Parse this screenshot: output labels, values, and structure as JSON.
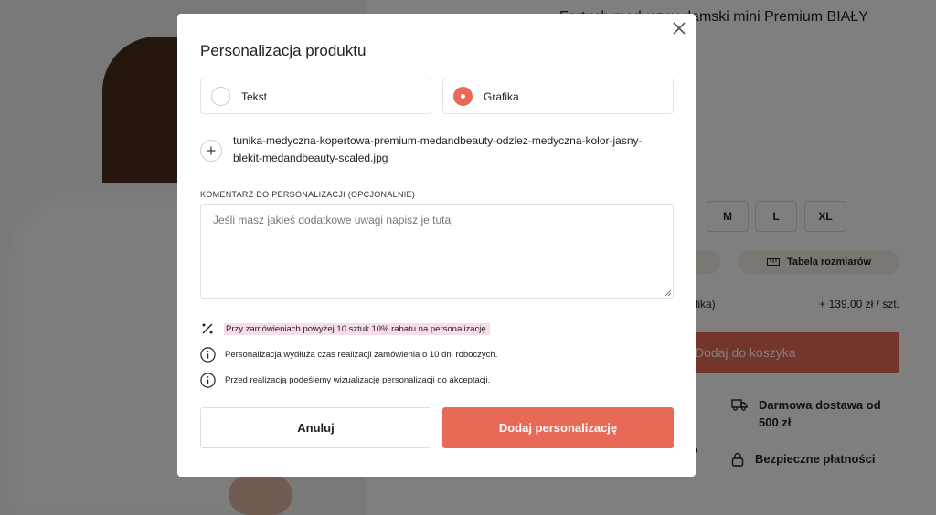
{
  "background": {
    "product_title": "Fartuch medyczny damski mini Premium BIAŁY",
    "sizes": [
      "M",
      "L",
      "XL"
    ],
    "size_chart_label": "Tabela rozmiarów",
    "price_label": "fika)",
    "price_value": "+ 139.00 zł / szt.",
    "add_to_cart": "Dodaj do koszyka",
    "feature_shipping": "Darmowa dostawa od 500 zł",
    "feature_payments": "Bezpieczne płatności",
    "edge_char_1": "i",
    "edge_char_2": "y"
  },
  "modal": {
    "title": "Personalizacja produktu",
    "option_text": "Tekst",
    "option_graphic": "Grafika",
    "selected_option": "Grafika",
    "file_name": "tunika-medyczna-kopertowa-premium-medandbeauty-odziez-medyczna-kolor-jasny-blekit-medandbeauty-scaled.jpg",
    "comment_label": "KOMENTARZ DO PERSONALIZACJI (OPCJONALNIE)",
    "comment_placeholder": "Jeśli masz jakieś dodatkowe uwagi napisz je tutaj",
    "comment_value": "",
    "info_discount": "Przy zamówieniach powyżej 10 sztuk 10% rabatu na personalizację.",
    "info_time": "Personalizacja wydłuża czas realizacji zamówienia o 10 dni roboczych.",
    "info_visualization": "Przed realizacją podeślemy wizualizację personalizacji do akceptacji.",
    "cancel_label": "Anuluj",
    "add_label": "Dodaj personalizację"
  },
  "colors": {
    "accent": "#e86a56",
    "highlight": "#f6dde9",
    "overlay": "rgba(0,0,0,0.5)"
  },
  "icons": {
    "close": "close-icon",
    "upload": "plus-icon",
    "discount": "percent-icon",
    "info": "info-icon",
    "truck": "truck-icon",
    "lock": "lock-icon",
    "ruler": "ruler-icon"
  }
}
